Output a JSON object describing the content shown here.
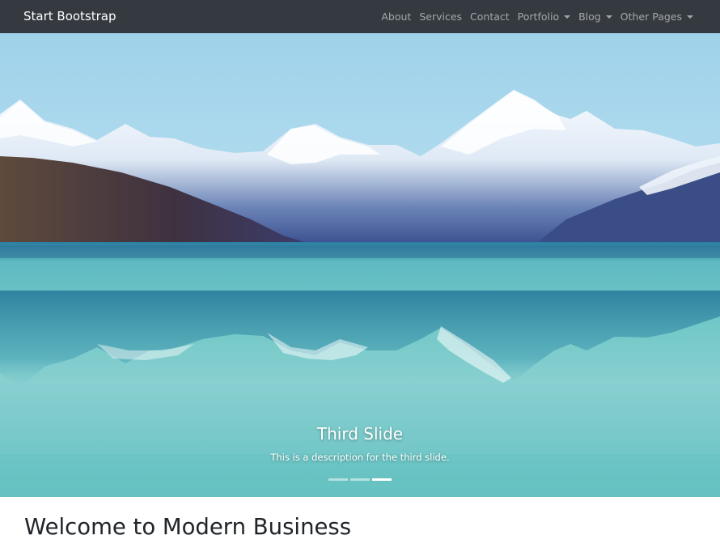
{
  "navbar": {
    "brand": "Start Bootstrap",
    "links": [
      {
        "label": "About",
        "dropdown": false
      },
      {
        "label": "Services",
        "dropdown": false
      },
      {
        "label": "Contact",
        "dropdown": false
      },
      {
        "label": "Portfolio",
        "dropdown": true
      },
      {
        "label": "Blog",
        "dropdown": true
      },
      {
        "label": "Other Pages",
        "dropdown": true
      }
    ],
    "background": "#343a40"
  },
  "carousel": {
    "active_slide": 3,
    "slide_count": 3,
    "caption": {
      "title": "Third Slide",
      "text": "This is a description for the third slide."
    },
    "image_description": "mountain-lake-icon"
  },
  "main": {
    "heading": "Welcome to Modern Business"
  }
}
